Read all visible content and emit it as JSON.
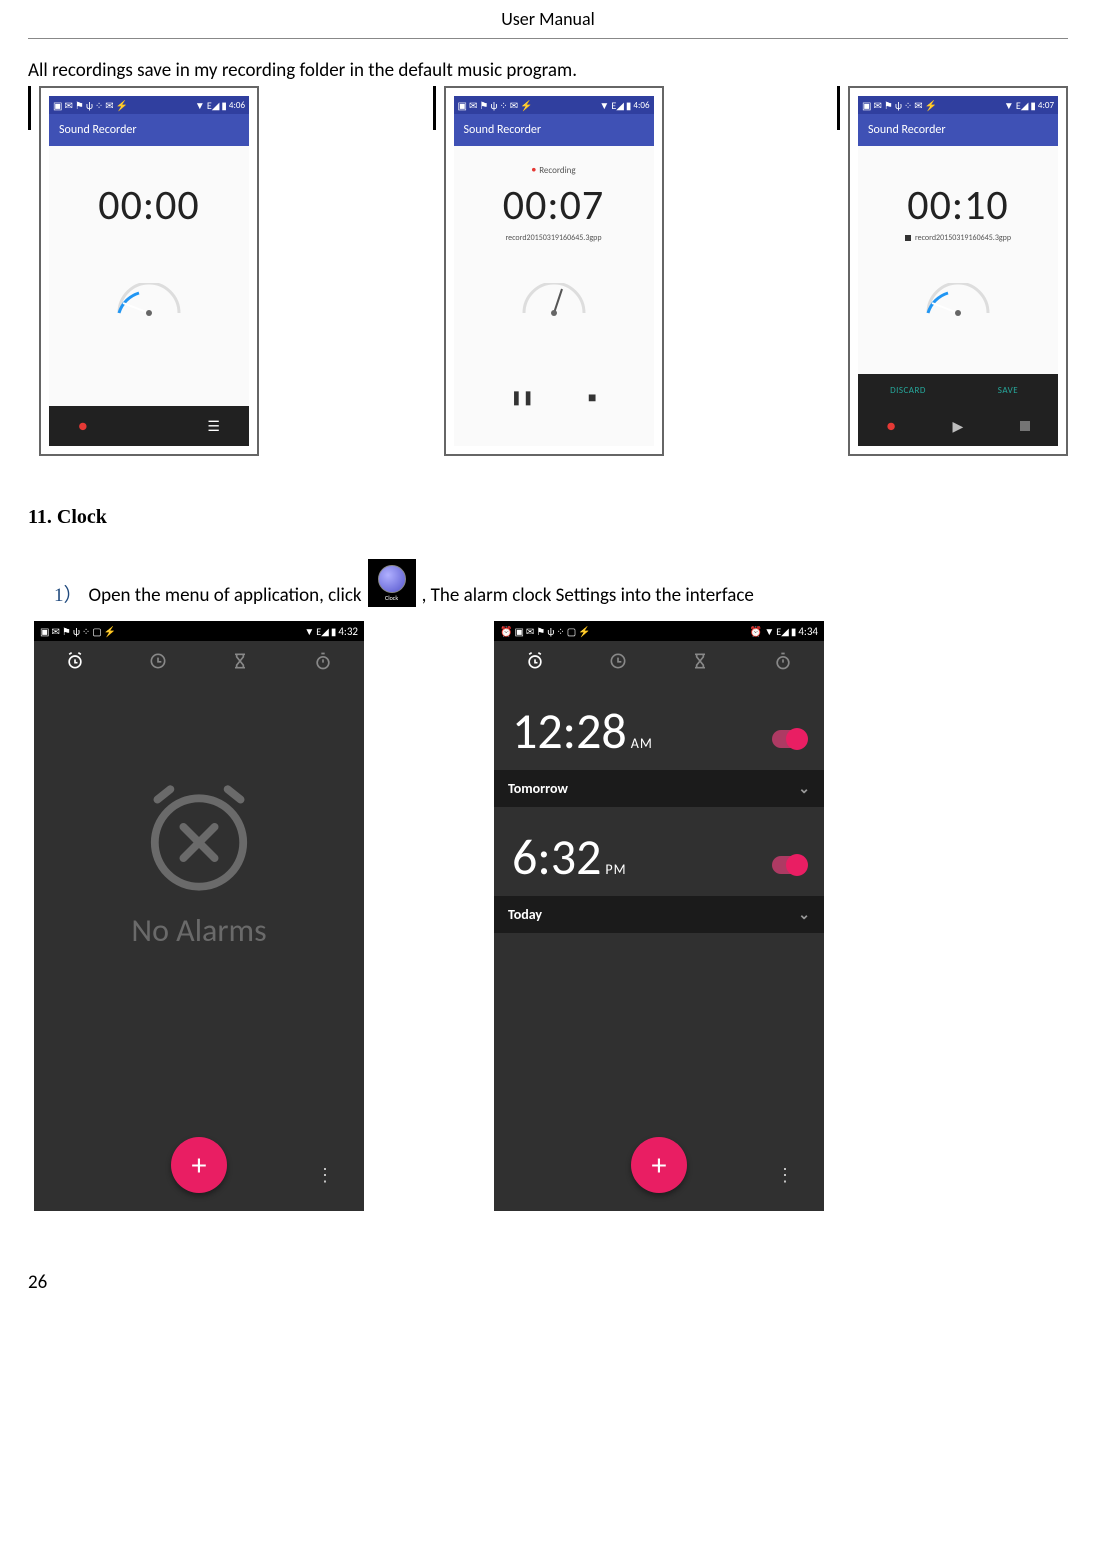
{
  "header": "User    Manual",
  "intro": "All recordings save in my recording folder in the default music program.",
  "recorder": {
    "title": "Sound Recorder",
    "shot1": {
      "time": "4:06",
      "timer": "00:00"
    },
    "shot2": {
      "time": "4:06",
      "status": "Recording",
      "timer": "00:07",
      "file": "record20150319160645.3gpp"
    },
    "shot3": {
      "time": "4:07",
      "timer": "00:10",
      "file": "record20150319160645.3gpp",
      "discard": "DISCARD",
      "save": "SAVE"
    }
  },
  "section": {
    "title": "11. Clock"
  },
  "step1": {
    "num": "1）",
    "text_a": "Open the menu of application, click",
    "icon_label": "Clock",
    "text_b": ",  The alarm clock Settings into the interface"
  },
  "clock": {
    "shot1": {
      "time": "4:32",
      "empty": "No Alarms"
    },
    "shot2": {
      "time": "4:34",
      "alarm1": {
        "hm": "12:28",
        "ampm": "AM",
        "day": "Tomorrow"
      },
      "alarm2": {
        "hm": "6:32",
        "ampm": "PM",
        "day": "Today"
      }
    }
  },
  "page_number": "26"
}
